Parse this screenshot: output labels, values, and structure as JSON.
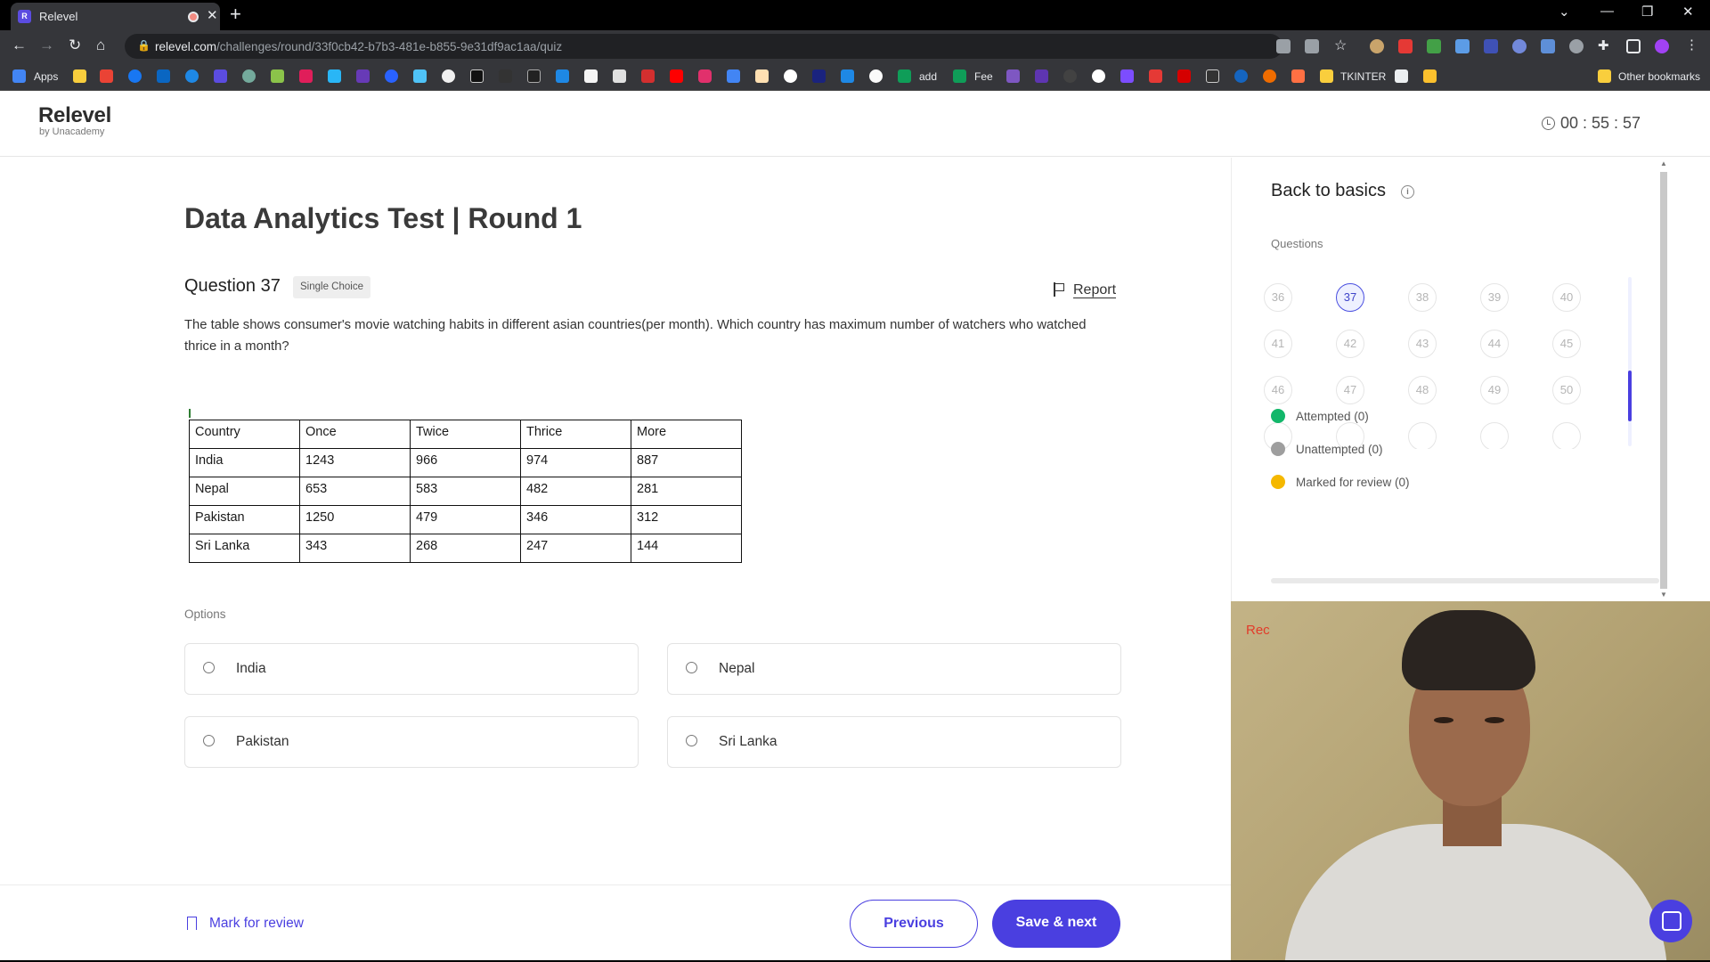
{
  "browser": {
    "tab_title": "Relevel",
    "tab_favicon_letter": "R",
    "url_domain": "relevel.com",
    "url_path": "/challenges/round/33f0cb42-b7b3-481e-b855-9e31df9ac1aa/quiz",
    "bookmarks": {
      "apps": "Apps",
      "add": "add",
      "fee": "Fee",
      "tkinter": "TKINTER",
      "other": "Other bookmarks"
    }
  },
  "header": {
    "logo": "Relevel",
    "logo_sub": "by Unacademy",
    "timer": "00 : 55 : 57"
  },
  "quiz": {
    "test_title": "Data Analytics Test | Round 1",
    "question_number": "Question 37",
    "question_type": "Single Choice",
    "report": "Report",
    "question_text": "The table shows consumer's movie watching habits in different asian countries(per month). Which country has maximum number of watchers who watched thrice in a month?",
    "table": {
      "headers": [
        "Country",
        "Once",
        "Twice",
        "Thrice",
        "More"
      ],
      "rows": [
        [
          "India",
          "1243",
          "966",
          "974",
          "887"
        ],
        [
          "Nepal",
          "653",
          "583",
          "482",
          "281"
        ],
        [
          "Pakistan",
          "1250",
          "479",
          "346",
          "312"
        ],
        [
          "Sri Lanka",
          "343",
          "268",
          "247",
          "144"
        ]
      ]
    },
    "options_heading": "Options",
    "options": [
      "India",
      "Nepal",
      "Pakistan",
      "Sri Lanka"
    ]
  },
  "side": {
    "title": "Back to basics",
    "questions_label": "Questions",
    "question_numbers": [
      "36",
      "37",
      "38",
      "39",
      "40",
      "41",
      "42",
      "43",
      "44",
      "45",
      "46",
      "47",
      "48",
      "49",
      "50"
    ],
    "current_question": "37",
    "legend": {
      "attempted": "Attempted (0)",
      "unattempted": "Unattempted (0)",
      "marked": "Marked for review (0)"
    },
    "legend_colors": {
      "attempted": "#12b76a",
      "unattempted": "#9e9e9e",
      "marked": "#f5b800"
    }
  },
  "webcam": {
    "rec_label": "Rec"
  },
  "footer": {
    "mark_for_review": "Mark for review",
    "previous": "Previous",
    "save_next": "Save & next"
  },
  "colors": {
    "accent": "#4a3fe0"
  }
}
